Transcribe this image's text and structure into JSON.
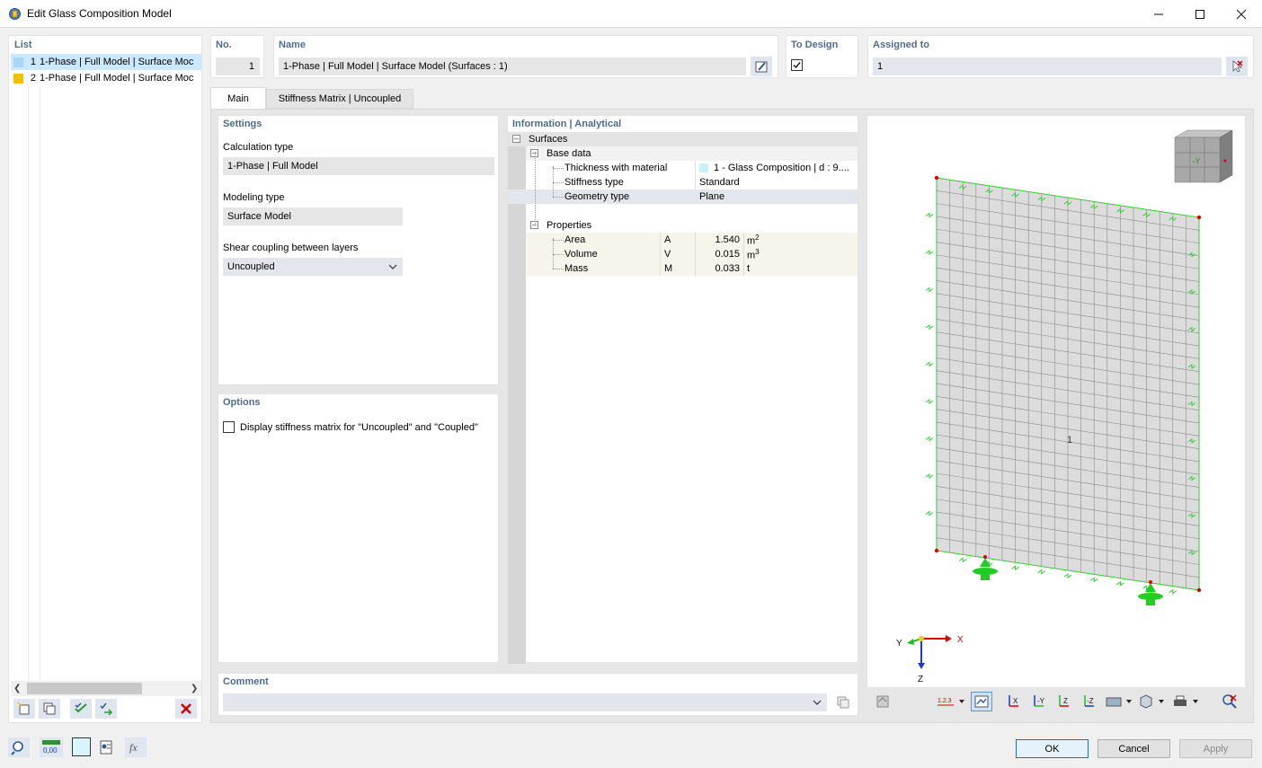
{
  "window": {
    "title": "Edit Glass Composition Model"
  },
  "list": {
    "header": "List",
    "items": [
      {
        "number": "1",
        "label": "1-Phase | Full Model | Surface Moc",
        "color": "#a7d8f5"
      },
      {
        "number": "2",
        "label": "1-Phase | Full Model | Surface Moc",
        "color": "#f2c000"
      }
    ]
  },
  "fields": {
    "no_label": "No.",
    "no_value": "1",
    "name_label": "Name",
    "name_value": "1-Phase | Full Model | Surface Model (Surfaces : 1)",
    "to_design_label": "To Design",
    "to_design_checked": true,
    "assigned_label": "Assigned to",
    "assigned_value": "1"
  },
  "tabs": [
    {
      "label": "Main",
      "active": true
    },
    {
      "label": "Stiffness Matrix | Uncoupled",
      "active": false
    }
  ],
  "settings": {
    "header": "Settings",
    "calc_type_label": "Calculation type",
    "calc_type_value": "1-Phase | Full Model",
    "modeling_type_label": "Modeling type",
    "modeling_type_value": "Surface Model",
    "shear_label": "Shear coupling between layers",
    "shear_value": "Uncoupled"
  },
  "options": {
    "header": "Options",
    "display_stiffness_label": "Display stiffness matrix for \"Uncoupled\" and \"Coupled\"",
    "display_stiffness_checked": false
  },
  "info": {
    "header": "Information | Analytical",
    "surfaces": "Surfaces",
    "base_data": "Base data",
    "thickness_label": "Thickness with material",
    "thickness_value": "1 - Glass Composition | d : 9....",
    "stiffness_label": "Stiffness type",
    "stiffness_value": "Standard",
    "geometry_label": "Geometry type",
    "geometry_value": "Plane",
    "properties": "Properties",
    "area_label": "Area",
    "area_sym": "A",
    "area_value": "1.540",
    "area_unit": "m",
    "volume_label": "Volume",
    "volume_sym": "V",
    "volume_value": "0.015",
    "volume_unit": "m",
    "mass_label": "Mass",
    "mass_sym": "M",
    "mass_value": "0.033",
    "mass_unit": "t",
    "sup2": "2",
    "sup3": "3"
  },
  "viewport": {
    "surface_label": "1",
    "axis_x": "X",
    "axis_y": "Y",
    "axis_z": "Z",
    "cube_face": "-Y"
  },
  "comment": {
    "label": "Comment",
    "value": ""
  },
  "buttons": {
    "ok": "OK",
    "cancel": "Cancel",
    "apply": "Apply"
  },
  "bottom_tool": {
    "units_text": "0,00"
  },
  "colors": {
    "accent_header": "#4f6c8a",
    "selection": "#cce8ff",
    "mesh_edge": "#33cc33",
    "support": "#22cc22"
  }
}
